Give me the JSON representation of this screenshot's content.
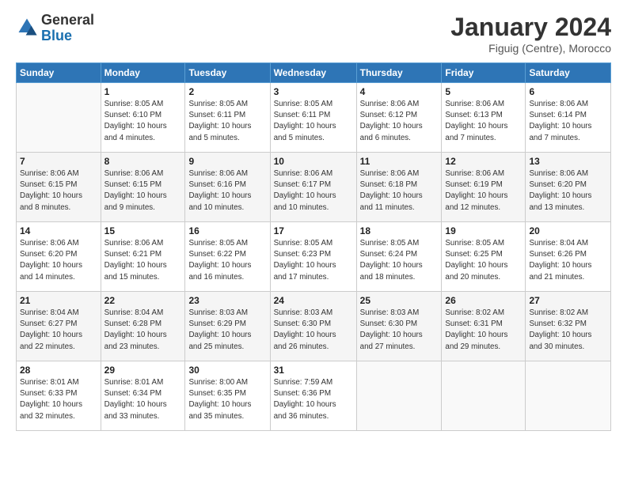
{
  "logo": {
    "general": "General",
    "blue": "Blue"
  },
  "title": "January 2024",
  "subtitle": "Figuig (Centre), Morocco",
  "headers": [
    "Sunday",
    "Monday",
    "Tuesday",
    "Wednesday",
    "Thursday",
    "Friday",
    "Saturday"
  ],
  "weeks": [
    [
      {
        "day": "",
        "detail": ""
      },
      {
        "day": "1",
        "detail": "Sunrise: 8:05 AM\nSunset: 6:10 PM\nDaylight: 10 hours\nand 4 minutes."
      },
      {
        "day": "2",
        "detail": "Sunrise: 8:05 AM\nSunset: 6:11 PM\nDaylight: 10 hours\nand 5 minutes."
      },
      {
        "day": "3",
        "detail": "Sunrise: 8:05 AM\nSunset: 6:11 PM\nDaylight: 10 hours\nand 5 minutes."
      },
      {
        "day": "4",
        "detail": "Sunrise: 8:06 AM\nSunset: 6:12 PM\nDaylight: 10 hours\nand 6 minutes."
      },
      {
        "day": "5",
        "detail": "Sunrise: 8:06 AM\nSunset: 6:13 PM\nDaylight: 10 hours\nand 7 minutes."
      },
      {
        "day": "6",
        "detail": "Sunrise: 8:06 AM\nSunset: 6:14 PM\nDaylight: 10 hours\nand 7 minutes."
      }
    ],
    [
      {
        "day": "7",
        "detail": "Sunrise: 8:06 AM\nSunset: 6:15 PM\nDaylight: 10 hours\nand 8 minutes."
      },
      {
        "day": "8",
        "detail": "Sunrise: 8:06 AM\nSunset: 6:15 PM\nDaylight: 10 hours\nand 9 minutes."
      },
      {
        "day": "9",
        "detail": "Sunrise: 8:06 AM\nSunset: 6:16 PM\nDaylight: 10 hours\nand 10 minutes."
      },
      {
        "day": "10",
        "detail": "Sunrise: 8:06 AM\nSunset: 6:17 PM\nDaylight: 10 hours\nand 10 minutes."
      },
      {
        "day": "11",
        "detail": "Sunrise: 8:06 AM\nSunset: 6:18 PM\nDaylight: 10 hours\nand 11 minutes."
      },
      {
        "day": "12",
        "detail": "Sunrise: 8:06 AM\nSunset: 6:19 PM\nDaylight: 10 hours\nand 12 minutes."
      },
      {
        "day": "13",
        "detail": "Sunrise: 8:06 AM\nSunset: 6:20 PM\nDaylight: 10 hours\nand 13 minutes."
      }
    ],
    [
      {
        "day": "14",
        "detail": "Sunrise: 8:06 AM\nSunset: 6:20 PM\nDaylight: 10 hours\nand 14 minutes."
      },
      {
        "day": "15",
        "detail": "Sunrise: 8:06 AM\nSunset: 6:21 PM\nDaylight: 10 hours\nand 15 minutes."
      },
      {
        "day": "16",
        "detail": "Sunrise: 8:05 AM\nSunset: 6:22 PM\nDaylight: 10 hours\nand 16 minutes."
      },
      {
        "day": "17",
        "detail": "Sunrise: 8:05 AM\nSunset: 6:23 PM\nDaylight: 10 hours\nand 17 minutes."
      },
      {
        "day": "18",
        "detail": "Sunrise: 8:05 AM\nSunset: 6:24 PM\nDaylight: 10 hours\nand 18 minutes."
      },
      {
        "day": "19",
        "detail": "Sunrise: 8:05 AM\nSunset: 6:25 PM\nDaylight: 10 hours\nand 20 minutes."
      },
      {
        "day": "20",
        "detail": "Sunrise: 8:04 AM\nSunset: 6:26 PM\nDaylight: 10 hours\nand 21 minutes."
      }
    ],
    [
      {
        "day": "21",
        "detail": "Sunrise: 8:04 AM\nSunset: 6:27 PM\nDaylight: 10 hours\nand 22 minutes."
      },
      {
        "day": "22",
        "detail": "Sunrise: 8:04 AM\nSunset: 6:28 PM\nDaylight: 10 hours\nand 23 minutes."
      },
      {
        "day": "23",
        "detail": "Sunrise: 8:03 AM\nSunset: 6:29 PM\nDaylight: 10 hours\nand 25 minutes."
      },
      {
        "day": "24",
        "detail": "Sunrise: 8:03 AM\nSunset: 6:30 PM\nDaylight: 10 hours\nand 26 minutes."
      },
      {
        "day": "25",
        "detail": "Sunrise: 8:03 AM\nSunset: 6:30 PM\nDaylight: 10 hours\nand 27 minutes."
      },
      {
        "day": "26",
        "detail": "Sunrise: 8:02 AM\nSunset: 6:31 PM\nDaylight: 10 hours\nand 29 minutes."
      },
      {
        "day": "27",
        "detail": "Sunrise: 8:02 AM\nSunset: 6:32 PM\nDaylight: 10 hours\nand 30 minutes."
      }
    ],
    [
      {
        "day": "28",
        "detail": "Sunrise: 8:01 AM\nSunset: 6:33 PM\nDaylight: 10 hours\nand 32 minutes."
      },
      {
        "day": "29",
        "detail": "Sunrise: 8:01 AM\nSunset: 6:34 PM\nDaylight: 10 hours\nand 33 minutes."
      },
      {
        "day": "30",
        "detail": "Sunrise: 8:00 AM\nSunset: 6:35 PM\nDaylight: 10 hours\nand 35 minutes."
      },
      {
        "day": "31",
        "detail": "Sunrise: 7:59 AM\nSunset: 6:36 PM\nDaylight: 10 hours\nand 36 minutes."
      },
      {
        "day": "",
        "detail": ""
      },
      {
        "day": "",
        "detail": ""
      },
      {
        "day": "",
        "detail": ""
      }
    ]
  ]
}
